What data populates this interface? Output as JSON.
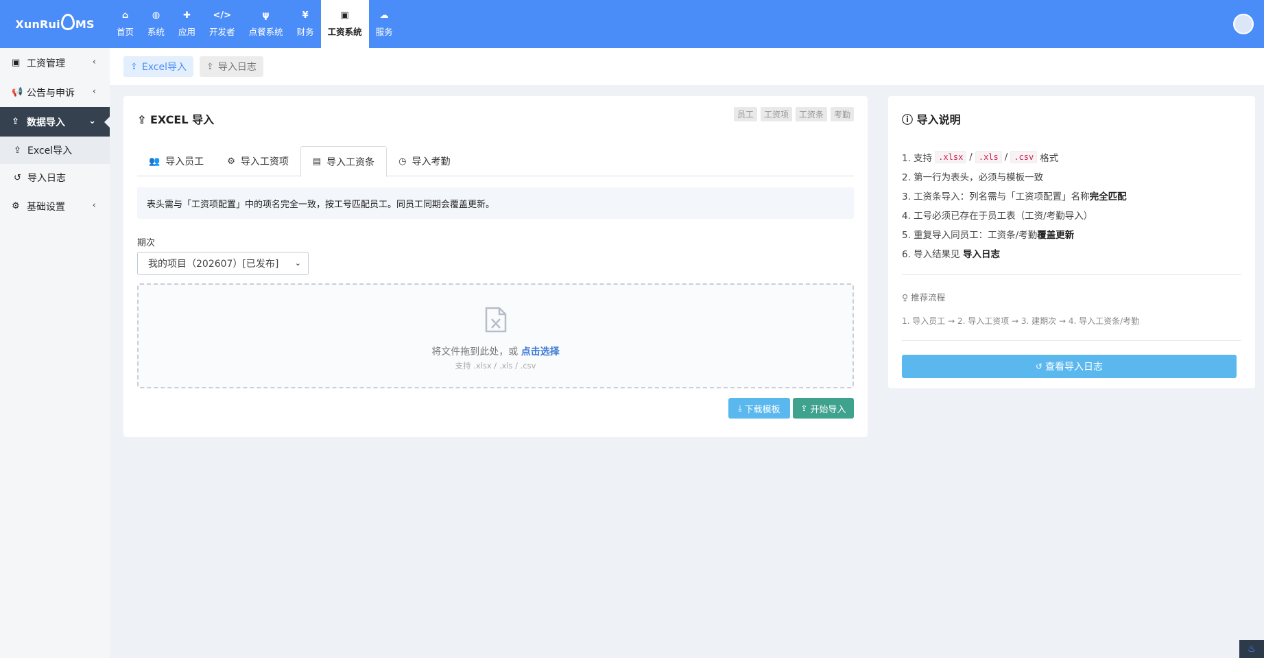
{
  "brand": {
    "logo_text_a": "XunRui",
    "logo_text_b": "MS"
  },
  "nav": [
    {
      "label": "首页",
      "icon": "⌂"
    },
    {
      "label": "系统",
      "icon": "◍"
    },
    {
      "label": "应用",
      "icon": "✚"
    },
    {
      "label": "开发者",
      "icon": "</>"
    },
    {
      "label": "点餐系统",
      "icon": "ψ"
    },
    {
      "label": "财务",
      "icon": "¥"
    },
    {
      "label": "工资系统",
      "icon": "▣"
    },
    {
      "label": "服务",
      "icon": "☁"
    }
  ],
  "sidebar": {
    "items": [
      {
        "label": "工资管理",
        "icon": "▣",
        "arrow": "‹"
      },
      {
        "label": "公告与申诉",
        "icon": "📢",
        "arrow": "‹"
      },
      {
        "label": "数据导入",
        "icon": "⇪",
        "arrow": "⌄"
      },
      {
        "label": "基础设置",
        "icon": "⚙",
        "arrow": "‹"
      }
    ],
    "subitems": [
      {
        "label": "Excel导入",
        "icon": "⇪"
      },
      {
        "label": "导入日志",
        "icon": "↺"
      }
    ]
  },
  "subbar": {
    "tab1": "Excel导入",
    "tab2": "导入日志"
  },
  "main": {
    "title": "EXCEL 导入",
    "tags": [
      "员工",
      "工资项",
      "工资条",
      "考勤"
    ],
    "tabs": [
      {
        "label": "导入员工",
        "icon": "👥"
      },
      {
        "label": "导入工资项",
        "icon": "⚙"
      },
      {
        "label": "导入工资条",
        "icon": "▤"
      },
      {
        "label": "导入考勤",
        "icon": "◷"
      }
    ],
    "notice": "表头需与「工资项配置」中的项名完全一致，按工号匹配员工。同员工同期会覆盖更新。",
    "period_label": "期次",
    "period_value": "我的项目（202607）[已发布]",
    "dropzone_text": "将文件拖到此处，或",
    "dropzone_link": "点击选择",
    "dropzone_sub": "支持 .xlsx / .xls / .csv",
    "download_btn": "下载模板",
    "start_btn": "开始导入"
  },
  "side_panel": {
    "title": "导入说明",
    "line1_prefix": "1. 支持",
    "formats": [
      ".xlsx",
      ".xls",
      ".csv"
    ],
    "line1_suffix": "格式",
    "line2": "2. 第一行为表头，必须与模板一致",
    "line3_a": "3. 工资条导入：列名需与「工资项配置」名称",
    "line3_b": "完全匹配",
    "line4": "4. 工号必须已存在于员工表（工资/考勤导入）",
    "line5_a": "5. 重复导入同员工：工资条/考勤",
    "line5_b": "覆盖更新",
    "line6_a": "6. 导入结果见",
    "line6_b": "导入日志",
    "flow_label": "推荐流程",
    "flow_text": "1. 导入员工 → 2. 导入工资项 → 3. 建期次 → 4. 导入工资条/考勤",
    "log_btn": "查看导入日志"
  },
  "colors": {
    "primary": "#4b8df8",
    "sidebar_active": "#364150",
    "info_btn": "#5bb8ef",
    "success_btn": "#3fa28d"
  }
}
